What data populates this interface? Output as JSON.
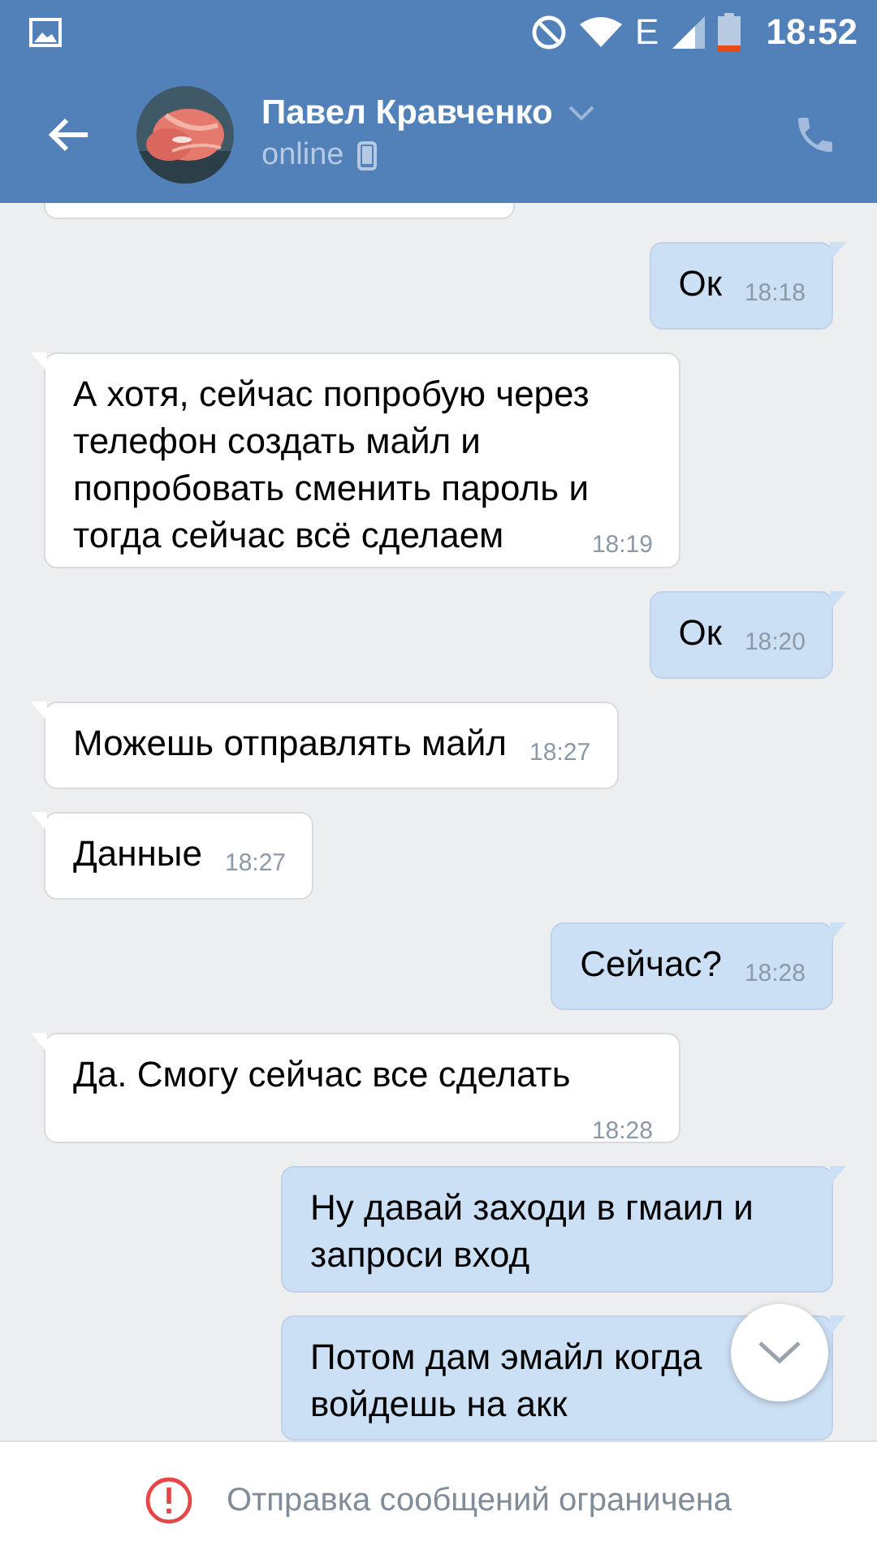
{
  "status_bar": {
    "network": "E",
    "time": "18:52"
  },
  "header": {
    "name": "Павел Кравченко",
    "status": "online"
  },
  "messages": [
    {
      "kind": "partial"
    },
    {
      "kind": "out",
      "text": "Ок",
      "time": "18:18"
    },
    {
      "kind": "in",
      "text": "А хотя, сейчас попробую через телефон создать майл и попробовать сменить пароль и тогда сейчас всё сделаем",
      "time": "18:19"
    },
    {
      "kind": "out",
      "text": "Ок",
      "time": "18:20"
    },
    {
      "kind": "in",
      "text": "Можешь отправлять майл",
      "time": "18:27"
    },
    {
      "kind": "in",
      "text": "Данные",
      "time": "18:27"
    },
    {
      "kind": "out",
      "text": "Сейчас?",
      "time": "18:28"
    },
    {
      "kind": "in",
      "text": "Да. Смогу сейчас все сделать",
      "time": "18:28"
    },
    {
      "kind": "out",
      "text": "Ну давай заходи в гмаил и запроси вход"
    },
    {
      "kind": "out",
      "text": "Потом дам эмайл когда войдешь на акк"
    }
  ],
  "footer": {
    "text": "Отправка сообщений ограничена"
  }
}
